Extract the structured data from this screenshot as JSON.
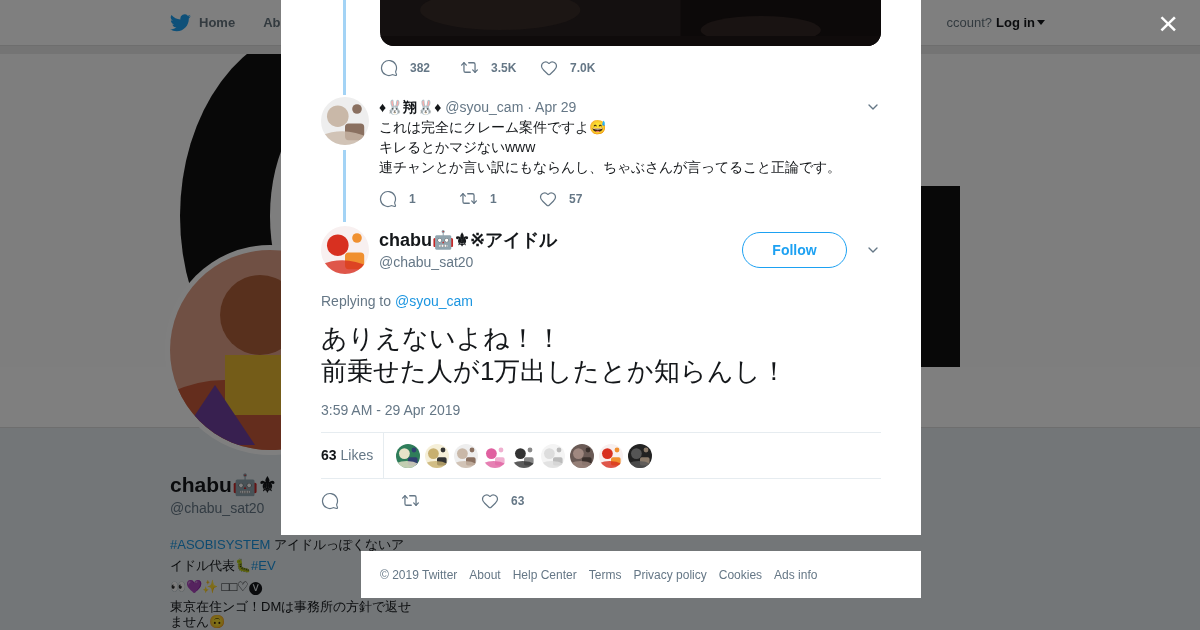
{
  "nav": {
    "items": [
      {
        "label": "Home"
      },
      {
        "label": "Ab"
      }
    ],
    "login_prompt": "ccount?",
    "login": "Log in"
  },
  "cover": {
    "kind": "picture"
  },
  "profile": {
    "avatar": {
      "kind": "picture"
    },
    "name": "chabu🤖⚜",
    "handle": "@chabu_sat20",
    "bio": [
      [
        {
          "kind": "hashtag",
          "text": "#ASOBISYSTEM"
        },
        {
          "kind": "text",
          "text": " アイドルっぽくないア"
        }
      ],
      [
        {
          "kind": "text",
          "text": "イドル代表🐛"
        },
        {
          "kind": "hashtag",
          "text": "#EV"
        }
      ],
      [
        {
          "kind": "text",
          "text": "👀💜✨ □□♡🅥"
        }
      ],
      [
        {
          "kind": "text",
          "text": "東京在住ンゴ！DMは事務所の方針で返せ"
        }
      ],
      [
        {
          "kind": "text",
          "text": "ません🙃"
        }
      ]
    ]
  },
  "modal": {
    "close": "×",
    "previous_tweet": {
      "media": {
        "kind": "picture"
      },
      "replies": "382",
      "retweets": "3.5K",
      "likes": "7.0K"
    },
    "reply": {
      "avatar": {
        "kind": "picture"
      },
      "name": "♦🐰翔🐰♦",
      "handle": "@syou_cam",
      "date": "· Apr 29",
      "lines": [
        "これは完全にクレーム案件ですよ😅",
        "キレるとかマジないwww",
        "連チャンとか言い訳にもならんし、ちゃぶさんが言ってること正論です。"
      ],
      "replies": "1",
      "retweets": "1",
      "likes": "57"
    },
    "tweet": {
      "avatar": {
        "kind": "picture"
      },
      "name": "chabu🤖⚜※アイドル",
      "handle": "@chabu_sat20",
      "follow": "Follow",
      "replying_to": "Replying to",
      "reply_handle": "@syou_cam",
      "lines": [
        "ありえないよね！！",
        "前乗せた人が1万出したとか知らんし！"
      ],
      "time": "3:59 AM - 29 Apr 2019",
      "like_count": "63",
      "like_label": "Likes",
      "liker_avatars": [
        {
          "kind": "picture"
        },
        {
          "kind": "picture"
        },
        {
          "kind": "picture"
        },
        {
          "kind": "picture"
        },
        {
          "kind": "picture"
        },
        {
          "kind": "picture"
        },
        {
          "kind": "picture"
        },
        {
          "kind": "picture"
        },
        {
          "kind": "picture"
        }
      ],
      "likes": "63"
    }
  },
  "footer": [
    "© 2019 Twitter",
    "About",
    "Help Center",
    "Terms",
    "Privacy policy",
    "Cookies",
    "Ads info"
  ]
}
